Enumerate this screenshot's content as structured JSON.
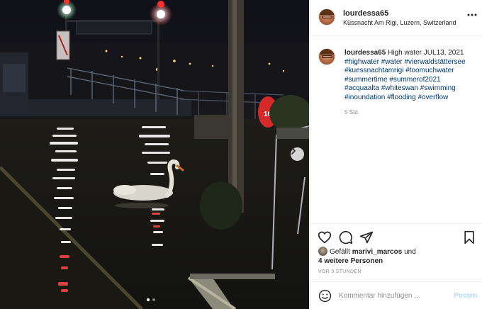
{
  "post": {
    "username": "lourdessa65",
    "location": "Küssnacht Am Rigi, Luzern, Switzerland",
    "caption": {
      "username": "lourdessa65",
      "text": "High water JUL13, 2021",
      "hashtags": [
        "#highwater",
        "#water",
        "#vierwaldstättersee",
        "#kuessnachtamrigi",
        "#toomuchwater",
        "#summertime",
        "#summerof2021",
        "#acquaalta",
        "#whiteswan",
        "#swimming",
        "#inoundation",
        "#flooding",
        "#overflow"
      ],
      "time_ago": "5 Std."
    },
    "likes": {
      "prefix": "Gefällt",
      "user": "marivi_marcos",
      "connector": "und",
      "others": "4 weitere Personen"
    },
    "posted_ago": "VOR 5 STUNDEN",
    "comment": {
      "placeholder": "Kommentar hinzufügen ...",
      "post_label": "Posten"
    },
    "carousel": {
      "count": 2,
      "active_index": 0
    },
    "icons": {
      "more": "more-options-icon",
      "like": "heart-icon",
      "comment": "comment-icon",
      "share": "paper-plane-icon",
      "save": "bookmark-icon",
      "emoji": "smiley-icon",
      "next": "chevron-right-icon"
    },
    "colors": {
      "hashtag": "#00376b",
      "post_button_disabled": "#b3dbff",
      "muted": "#8e8e8e"
    }
  }
}
